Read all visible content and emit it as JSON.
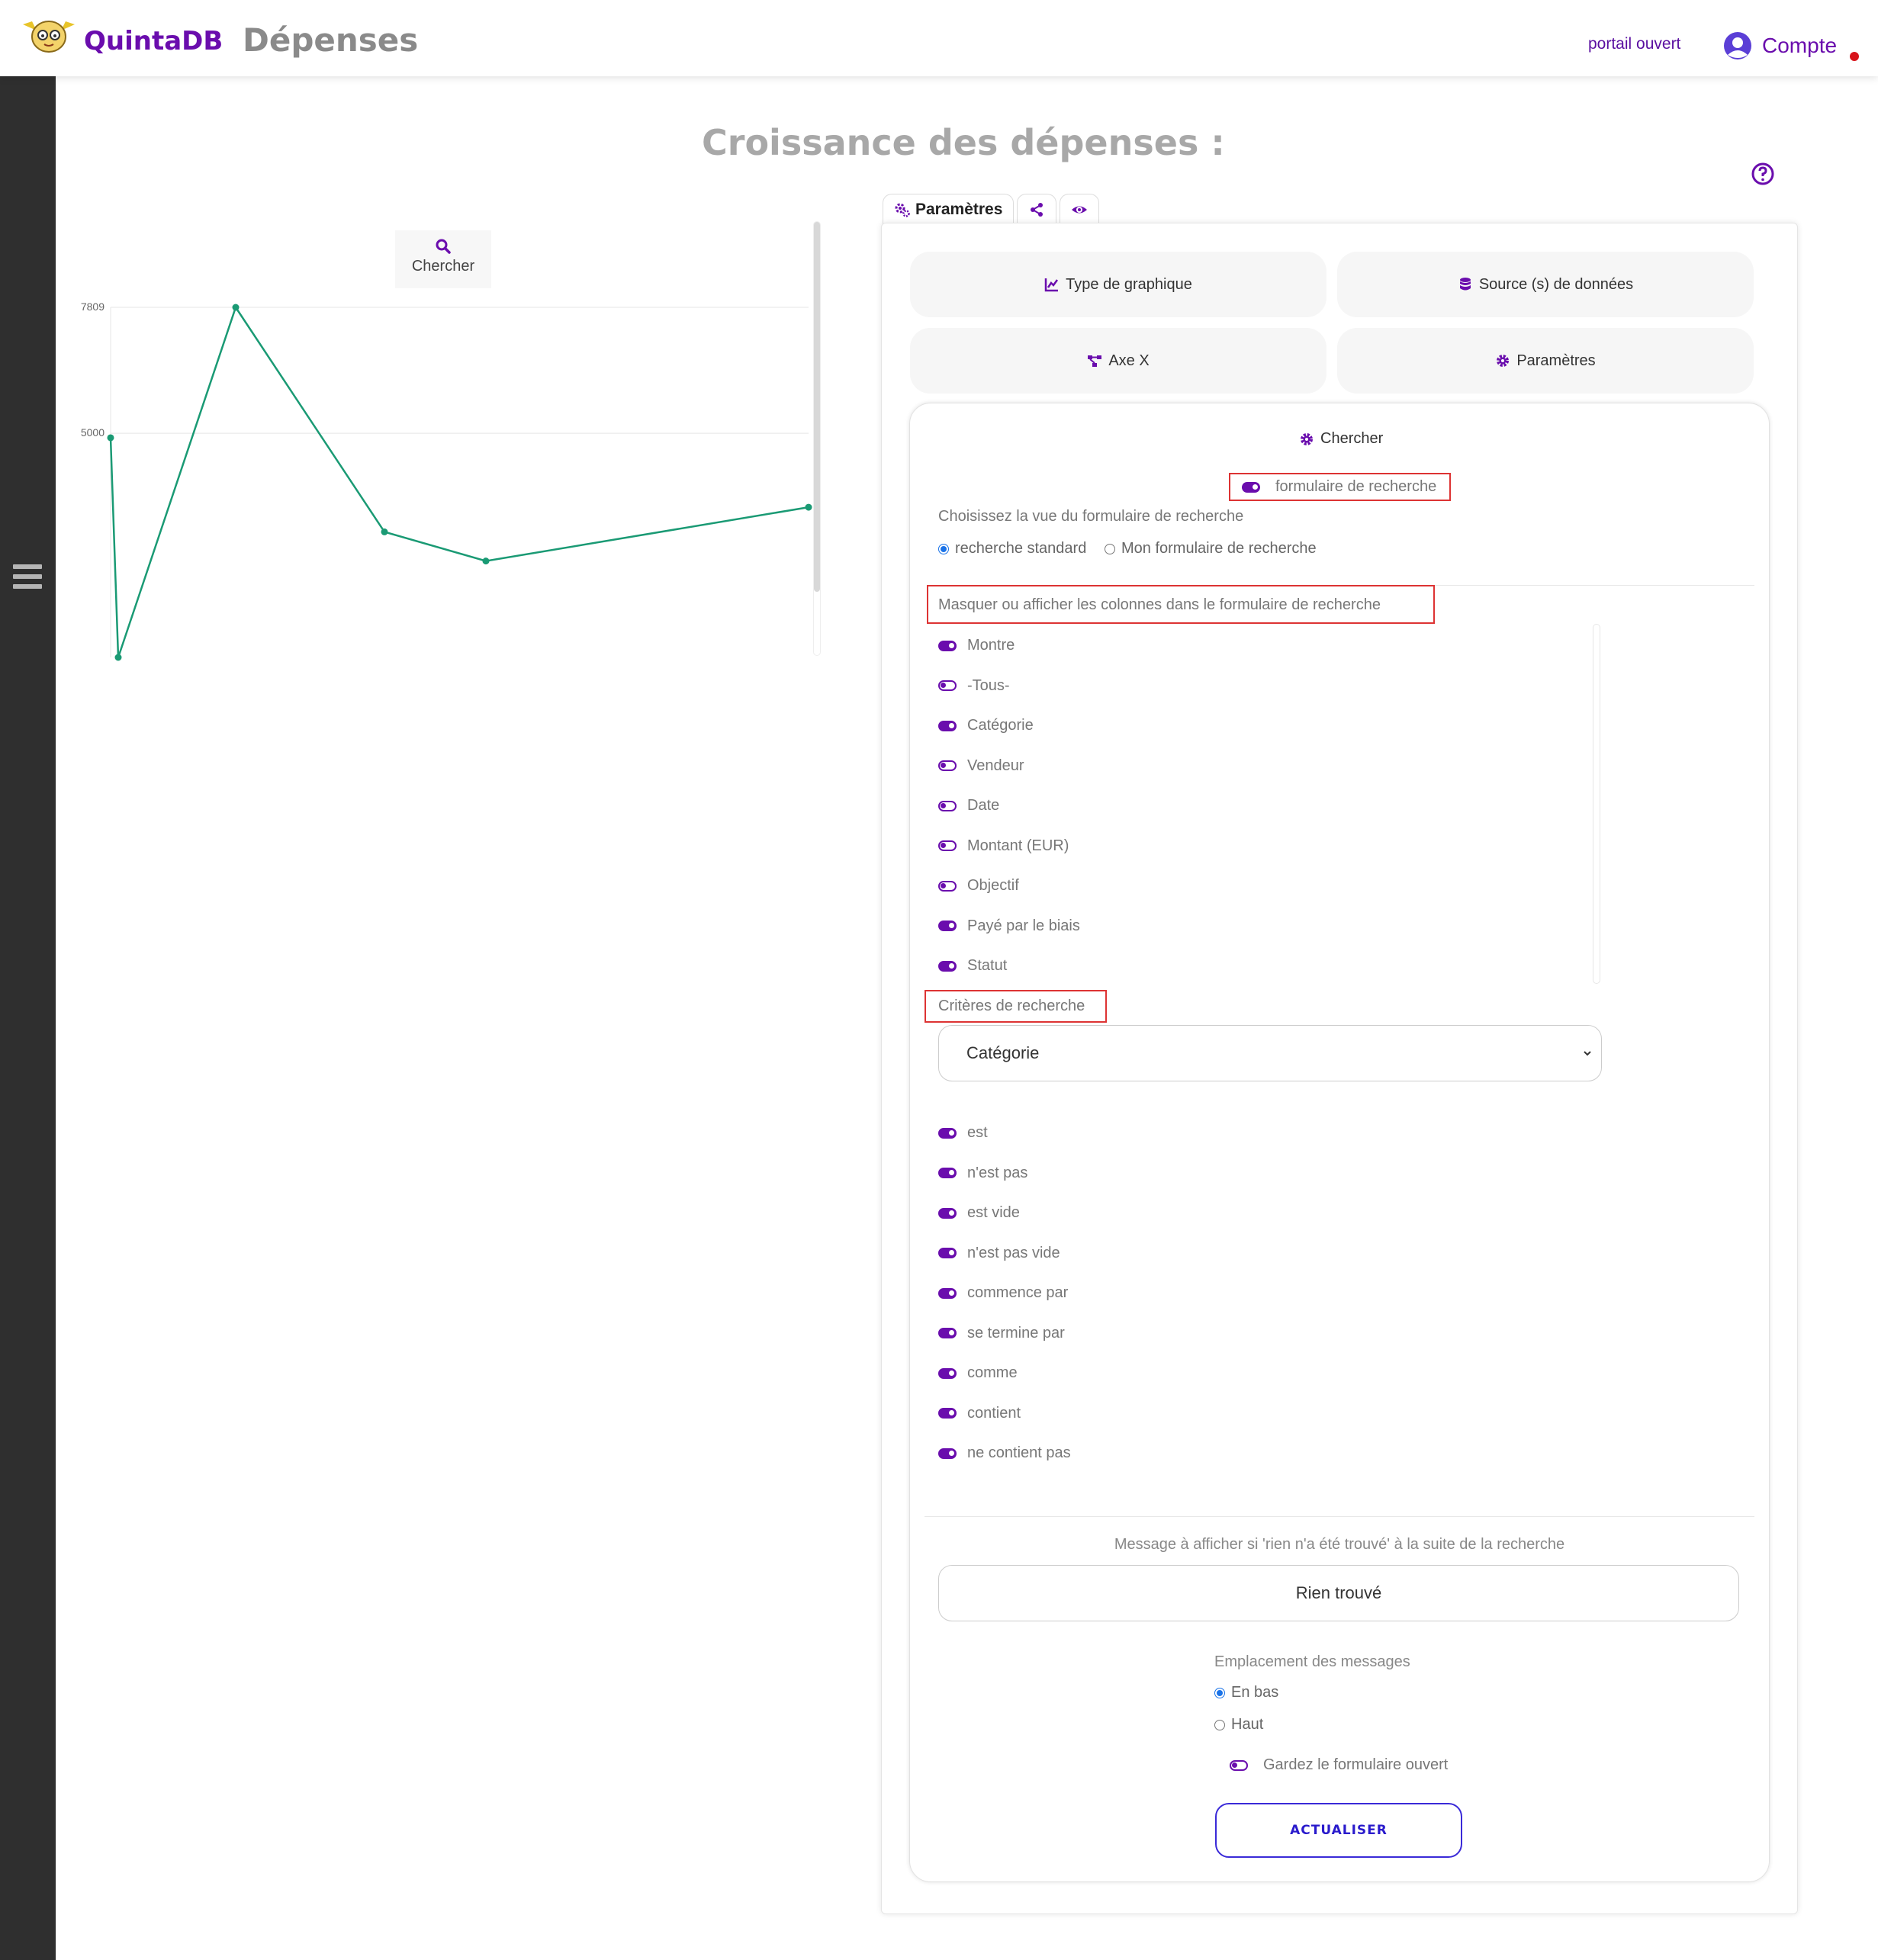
{
  "header": {
    "brand": "QuintaDB",
    "app_title": "Dépenses",
    "portal_link": "portail ouvert",
    "account_label": "Compte"
  },
  "page": {
    "heading": "Croissance des dépenses :"
  },
  "chart": {
    "search_label": "Chercher"
  },
  "chart_data": {
    "type": "line",
    "x": [
      1,
      2,
      3,
      4,
      5,
      6
    ],
    "values": [
      4900,
      0,
      7809,
      2800,
      2150,
      3350
    ],
    "ytick_labels": [
      "7809",
      "5000"
    ],
    "yticks": [
      7809,
      5000
    ],
    "ylim": [
      0,
      7809
    ],
    "grid": true,
    "color": "#1a9a74",
    "title": "",
    "xlabel": "",
    "ylabel": ""
  },
  "tabs": {
    "settings_label": "Paramètres"
  },
  "config_buttons": {
    "chart_type": "Type de graphique",
    "data_sources": "Source (s) de données",
    "x_axis": "Axe X",
    "parameters": "Paramètres"
  },
  "search_panel": {
    "title": "Chercher",
    "form_toggle_label": "formulaire de recherche",
    "view_label": "Choisissez la vue du formulaire de recherche",
    "view_options": [
      {
        "label": "recherche standard",
        "selected": true
      },
      {
        "label": "Mon formulaire de recherche",
        "selected": false
      }
    ],
    "columns_heading": "Masquer ou afficher les colonnes dans le formulaire de recherche",
    "columns": [
      {
        "label": "Montre",
        "on": true
      },
      {
        "label": "-Tous-",
        "on": false
      },
      {
        "label": "Catégorie",
        "on": true
      },
      {
        "label": "Vendeur",
        "on": false
      },
      {
        "label": "Date",
        "on": false
      },
      {
        "label": "Montant (EUR)",
        "on": false
      },
      {
        "label": "Objectif",
        "on": false
      },
      {
        "label": "Payé par le biais",
        "on": true
      },
      {
        "label": "Statut",
        "on": true
      }
    ],
    "criteria_heading": "Critères de recherche",
    "criteria_select": "Catégorie",
    "criteria": [
      {
        "label": "est",
        "on": true
      },
      {
        "label": "n'est pas",
        "on": true
      },
      {
        "label": "est vide",
        "on": true
      },
      {
        "label": "n'est pas vide",
        "on": true
      },
      {
        "label": "commence par",
        "on": true
      },
      {
        "label": "se termine par",
        "on": true
      },
      {
        "label": "comme",
        "on": true
      },
      {
        "label": "contient",
        "on": true
      },
      {
        "label": "ne contient pas",
        "on": true
      }
    ],
    "not_found_label": "Message à afficher si 'rien n'a été trouvé' à la suite de la recherche",
    "not_found_value": "Rien trouvé",
    "msg_location_label": "Emplacement des messages",
    "msg_location_options": [
      {
        "label": "En bas",
        "selected": true
      },
      {
        "label": "Haut",
        "selected": false
      }
    ],
    "keep_open_label": "Gardez le formulaire ouvert",
    "update_button": "ACTUALISER"
  }
}
